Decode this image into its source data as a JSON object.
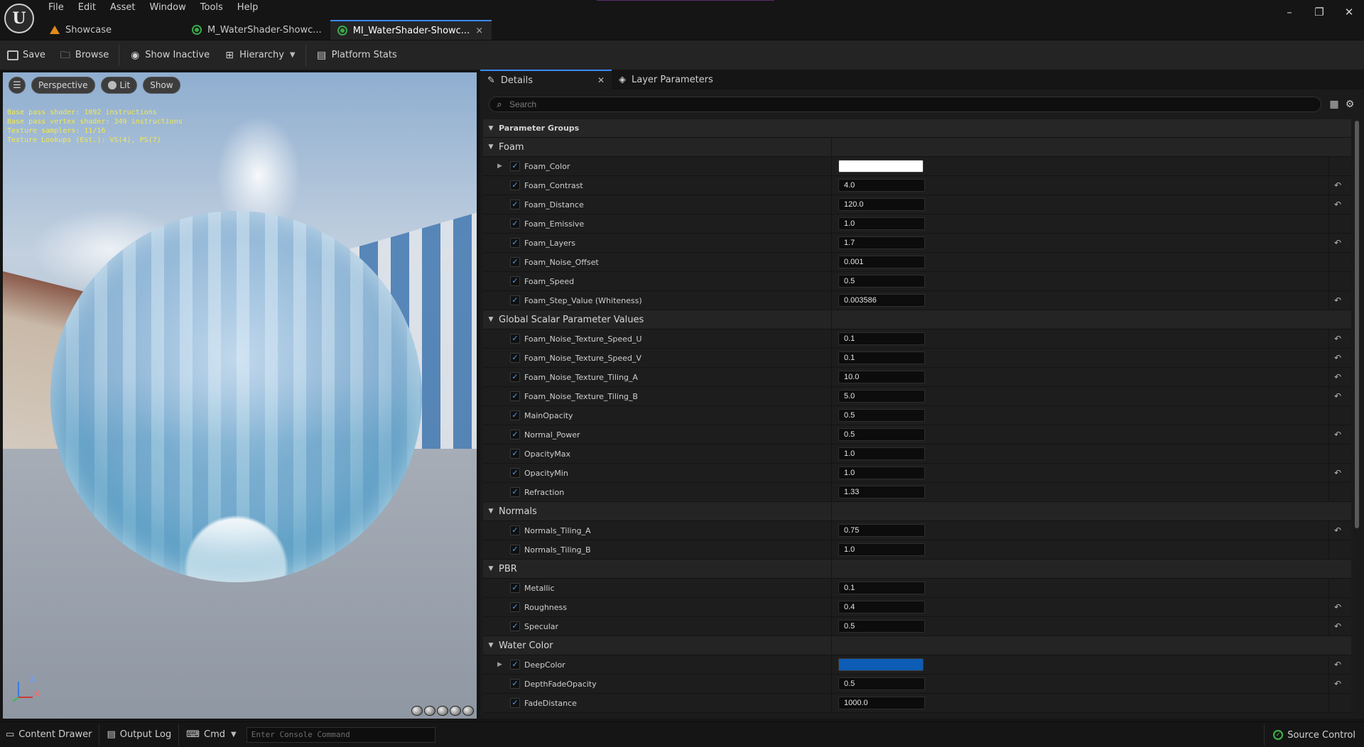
{
  "menu": [
    "File",
    "Edit",
    "Asset",
    "Window",
    "Tools",
    "Help"
  ],
  "window_controls": {
    "minimize": "–",
    "restore": "❐",
    "close": "✕"
  },
  "doc_tabs": [
    {
      "label": "Showcase",
      "icon": "level-icon"
    },
    {
      "label": "M_WaterShader-Showc...",
      "icon": "material-icon"
    },
    {
      "label": "MI_WaterShader-Showc...",
      "icon": "material-instance-icon",
      "close": "×"
    }
  ],
  "toolbar": {
    "save": "Save",
    "browse": "Browse",
    "show_inactive": "Show Inactive",
    "hierarchy": "Hierarchy",
    "platform_stats": "Platform Stats"
  },
  "viewport": {
    "perspective": "Perspective",
    "lit": "Lit",
    "show": "Show",
    "stats": [
      "Base pass shader: 1092 instructions",
      "Base pass vertex shader: 349 instructions",
      "Texture samplers: 11/16",
      "Texture Lookups (Est.): VS(4), PS(7)"
    ],
    "axis": {
      "z": "Z",
      "x": "X"
    }
  },
  "details": {
    "tab_details": "Details",
    "tab_layer_params": "Layer Parameters",
    "search_placeholder": "Search",
    "groups_header": "Parameter Groups",
    "groups": [
      {
        "name": "Foam",
        "params": [
          {
            "name": "Foam_Color",
            "type": "color",
            "color": "#ffffff",
            "expandable": true,
            "reset": false
          },
          {
            "name": "Foam_Contrast",
            "value": "4.0",
            "reset": true
          },
          {
            "name": "Foam_Distance",
            "value": "120.0",
            "reset": true
          },
          {
            "name": "Foam_Emissive",
            "value": "1.0",
            "reset": false
          },
          {
            "name": "Foam_Layers",
            "value": "1.7",
            "reset": true
          },
          {
            "name": "Foam_Noise_Offset",
            "value": "0.001",
            "reset": false
          },
          {
            "name": "Foam_Speed",
            "value": "0.5",
            "reset": false
          },
          {
            "name": "Foam_Step_Value (Whiteness)",
            "value": "0.003586",
            "reset": true
          }
        ]
      },
      {
        "name": "Global Scalar Parameter Values",
        "params": [
          {
            "name": "Foam_Noise_Texture_Speed_U",
            "value": "0.1",
            "reset": true
          },
          {
            "name": "Foam_Noise_Texture_Speed_V",
            "value": "0.1",
            "reset": true
          },
          {
            "name": "Foam_Noise_Texture_Tiling_A",
            "value": "10.0",
            "reset": true
          },
          {
            "name": "Foam_Noise_Texture_Tiling_B",
            "value": "5.0",
            "reset": true
          },
          {
            "name": "MainOpacity",
            "value": "0.5",
            "reset": false
          },
          {
            "name": "Normal_Power",
            "value": "0.5",
            "reset": true
          },
          {
            "name": "OpacityMax",
            "value": "1.0",
            "reset": false
          },
          {
            "name": "OpacityMin",
            "value": "1.0",
            "reset": true
          },
          {
            "name": "Refraction",
            "value": "1.33",
            "reset": false
          }
        ]
      },
      {
        "name": "Normals",
        "params": [
          {
            "name": "Normals_Tiling_A",
            "value": "0.75",
            "reset": true
          },
          {
            "name": "Normals_Tiling_B",
            "value": "1.0",
            "reset": false
          }
        ]
      },
      {
        "name": "PBR",
        "params": [
          {
            "name": "Metallic",
            "value": "0.1",
            "reset": false
          },
          {
            "name": "Roughness",
            "value": "0.4",
            "reset": true
          },
          {
            "name": "Specular",
            "value": "0.5",
            "reset": true
          }
        ]
      },
      {
        "name": "Water Color",
        "params": [
          {
            "name": "DeepColor",
            "type": "color",
            "color": "#0d5cb5",
            "expandable": true,
            "reset": true
          },
          {
            "name": "DepthFadeOpacity",
            "value": "0.5",
            "reset": true
          },
          {
            "name": "FadeDistance",
            "value": "1000.0",
            "reset": false
          }
        ]
      }
    ]
  },
  "statusbar": {
    "content_drawer": "Content Drawer",
    "output_log": "Output Log",
    "cmd": "Cmd",
    "console_placeholder": "Enter Console Command",
    "source_control": "Source Control"
  },
  "colors": {
    "accent": "#3c8aff",
    "checkbox": "#4aa3ff",
    "source_ok": "#3dbb4a"
  }
}
